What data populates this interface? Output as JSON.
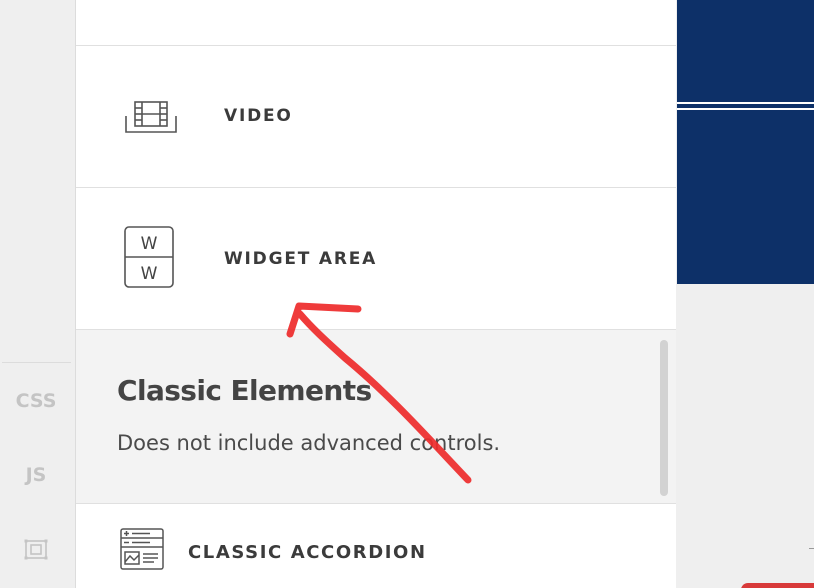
{
  "rail": {
    "css_label": "CSS",
    "js_label": "JS",
    "frame_icon": "frame-icon"
  },
  "elements": {
    "video": {
      "label": "VIDEO",
      "icon": "film-icon"
    },
    "widget_area": {
      "label": "WIDGET AREA",
      "icon": "widget-area-icon",
      "icon_letter": "W"
    },
    "classic_accordion": {
      "label": "CLASSIC ACCORDION",
      "icon": "accordion-icon"
    }
  },
  "classic_section": {
    "title": "Classic Elements",
    "description": "Does not include advanced controls."
  },
  "colors": {
    "banner": "#0d3068",
    "arrow": "#ee2b2b",
    "text_dark": "#3b3b3b",
    "rail_text": "#c4c4c4"
  }
}
